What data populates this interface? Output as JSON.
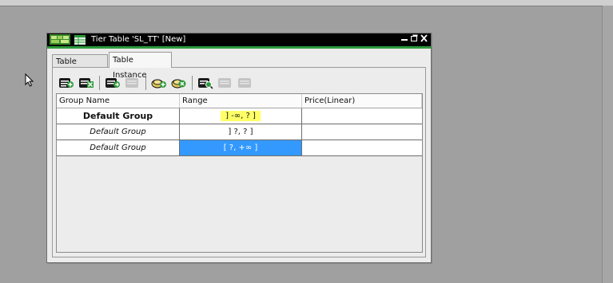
{
  "window": {
    "title": "Tier Table 'SL_TT' [New]",
    "controls": [
      "minimize",
      "restore",
      "close"
    ]
  },
  "tabs": [
    {
      "label": "Table Schema",
      "active": false
    },
    {
      "label": "Table Instance",
      "active": true
    }
  ],
  "toolbar": {
    "buttons": [
      {
        "icon": "add-row-icon",
        "enabled": true
      },
      {
        "icon": "delete-row-icon",
        "enabled": true
      },
      {
        "icon": "insert-row-icon",
        "enabled": true
      },
      {
        "icon": "row-disabled-icon",
        "enabled": false
      },
      {
        "icon": "add-group-icon",
        "enabled": true
      },
      {
        "icon": "delete-group-icon",
        "enabled": true
      },
      {
        "icon": "find-icon",
        "enabled": true
      },
      {
        "icon": "row-disabled-icon",
        "enabled": false
      },
      {
        "icon": "row-disabled-icon",
        "enabled": false
      }
    ]
  },
  "table": {
    "columns": [
      "Group Name",
      "Range",
      "Price(Linear)"
    ],
    "rows": [
      {
        "group": "Default Group",
        "range": "] -∞, ? ]",
        "price": "",
        "style": "bold",
        "range_highlight": "yellow"
      },
      {
        "group": "Default Group",
        "range": "] ?, ? ]",
        "price": "",
        "style": "italic",
        "range_highlight": "none"
      },
      {
        "group": "Default Group",
        "range": "[ ?, +∞ ]",
        "price": "",
        "style": "italic",
        "range_highlight": "selected"
      }
    ]
  },
  "colors": {
    "accent_green": "#2e9a3c",
    "selection_blue": "#3399ff",
    "highlight_yellow": "#ffff66"
  }
}
